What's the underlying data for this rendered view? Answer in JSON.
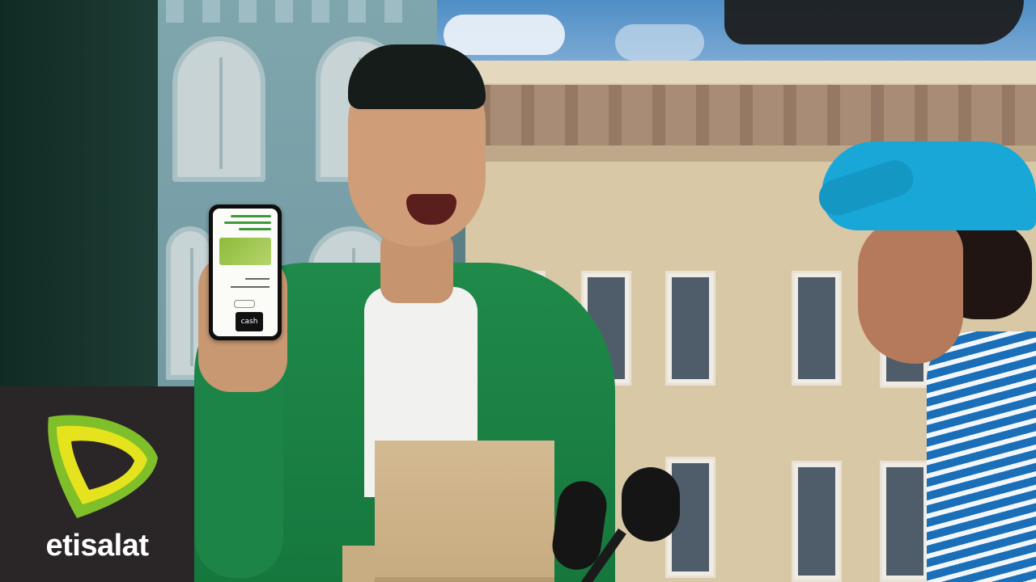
{
  "brand": {
    "logo_text": "etisalat",
    "colors": {
      "logo_green": "#7fbf2a",
      "logo_yellow": "#e5e21e",
      "logo_box": "#2a2527"
    }
  },
  "phone": {
    "app_badge": "cash"
  },
  "colors": {
    "jacket": "#1f8a4a",
    "cap": "#19a7d7"
  }
}
